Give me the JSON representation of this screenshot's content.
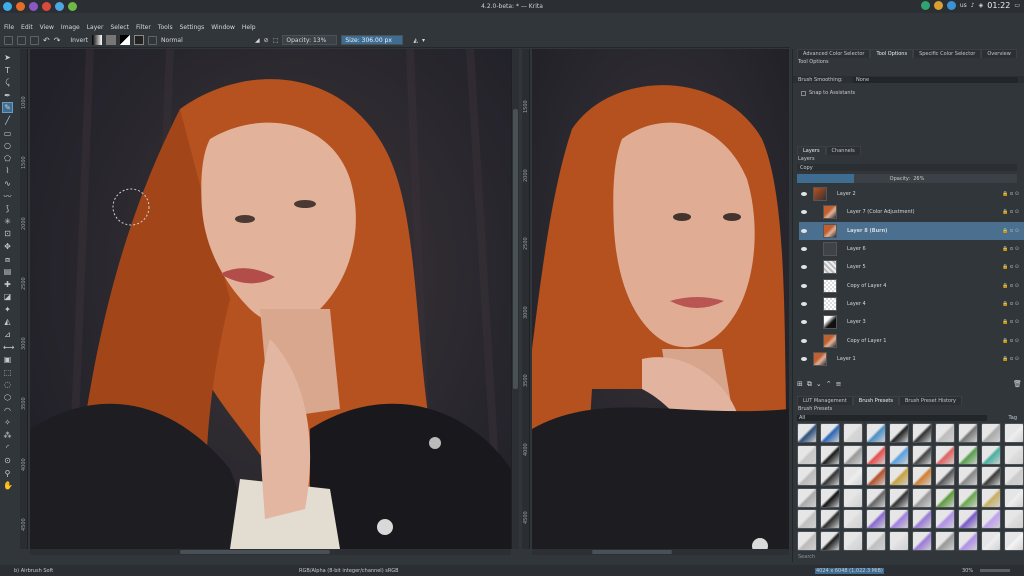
{
  "system": {
    "window_title": "4.2.0-beta: * — Krita",
    "keyboard_layout": "us",
    "clock": "01:22"
  },
  "menu": [
    "File",
    "Edit",
    "View",
    "Image",
    "Layer",
    "Select",
    "Filter",
    "Tools",
    "Settings",
    "Window",
    "Help"
  ],
  "toolbar": {
    "invert_label": "Invert",
    "blend_mode": "Normal",
    "opacity_label": "Opacity:",
    "opacity_value": "13%",
    "size_label": "Size:",
    "size_value": "306.00 px"
  },
  "rulers": {
    "left_canvas": [
      "1000",
      "1500",
      "2000",
      "2500",
      "3000",
      "3500",
      "4000",
      "4500"
    ],
    "right_canvas": [
      "1500",
      "2000",
      "2500",
      "3000",
      "3500",
      "4000",
      "4500"
    ]
  },
  "docker": {
    "top_tabs": [
      "Advanced Color Selector",
      "Tool Options",
      "Specific Color Selector",
      "Overview"
    ],
    "active_top_tab": "Tool Options",
    "tool_options_title": "Tool Options",
    "brush_smoothing_label": "Brush Smoothing:",
    "brush_smoothing_value": "None",
    "snap_label": "Snap to Assistants",
    "layer_tabs": [
      "Layers",
      "Channels"
    ],
    "layers_title": "Layers",
    "blend_value": "Copy",
    "opacity_label": "Opacity:",
    "opacity_value": "26%",
    "layers": [
      {
        "name": "Layer 2",
        "indent": 0,
        "kind": "group",
        "selected": false
      },
      {
        "name": "Layer 7 (Color Adjustment)",
        "indent": 1,
        "kind": "photo",
        "selected": false
      },
      {
        "name": "Layer 8 (Burn)",
        "indent": 1,
        "kind": "photo",
        "selected": true
      },
      {
        "name": "Layer 6",
        "indent": 1,
        "kind": "blank",
        "selected": false
      },
      {
        "name": "Layer 5",
        "indent": 1,
        "kind": "sketch",
        "selected": false
      },
      {
        "name": "Copy of Layer 4",
        "indent": 1,
        "kind": "transparent",
        "selected": false
      },
      {
        "name": "Layer 4",
        "indent": 1,
        "kind": "transparent",
        "selected": false
      },
      {
        "name": "Layer 3",
        "indent": 1,
        "kind": "dark",
        "selected": false
      },
      {
        "name": "Copy of Layer 1",
        "indent": 1,
        "kind": "photo",
        "selected": false
      },
      {
        "name": "Layer 1",
        "indent": 0,
        "kind": "photo",
        "selected": false
      }
    ],
    "bottom_tabs": [
      "LUT Management",
      "Brush Presets",
      "Brush Preset History"
    ],
    "active_bottom_tab": "Brush Presets",
    "presets_title": "Brush Presets",
    "presets_filter": "All",
    "tag_label": "Tag",
    "search_placeholder": "Search"
  },
  "status": {
    "brush": "b) Airbrush Soft",
    "color_info": "RGB/Alpha (8-bit integer/channel)  sRGB",
    "image_size": "4024 x 6048 (1,022.3 MiB)",
    "zoom": "30%"
  }
}
